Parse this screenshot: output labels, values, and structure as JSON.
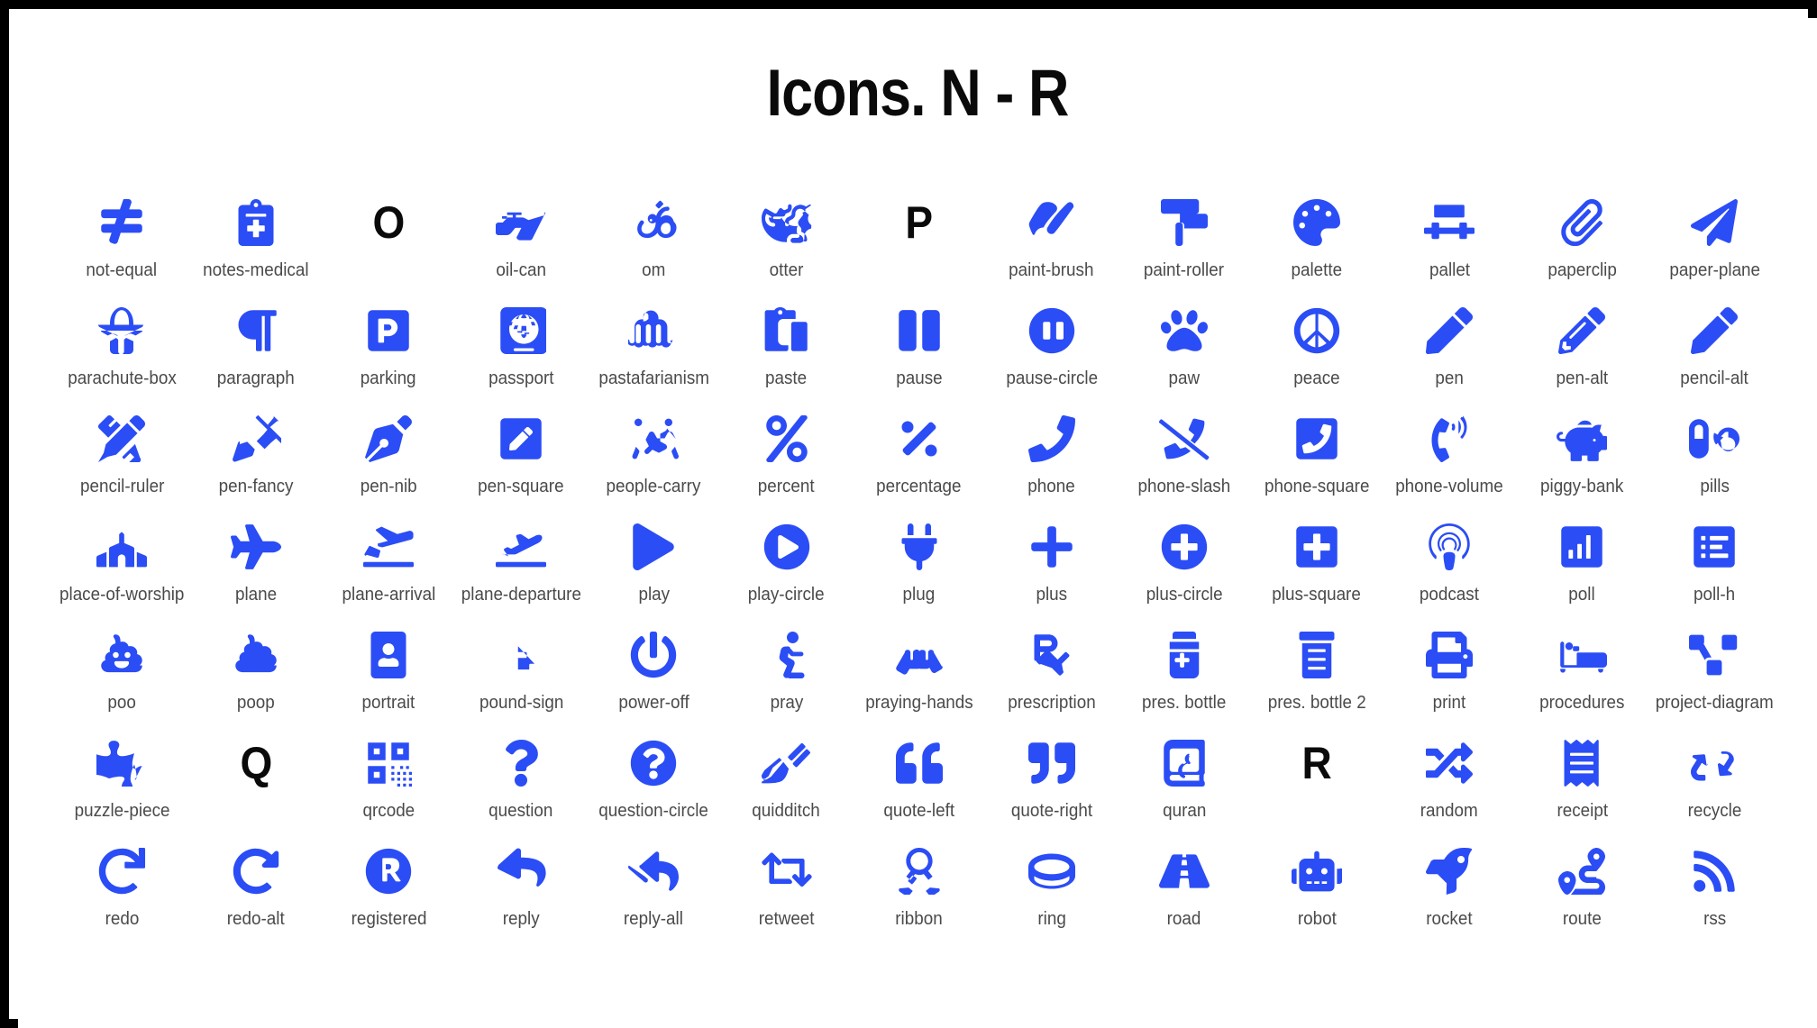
{
  "page": {
    "title": "Icons. N - R",
    "icon_color": "#2b4df5",
    "label_color": "#4a4a4a",
    "title_color": "#0a0a0a",
    "background_color": "#ffffff",
    "frame_color": "#000000",
    "columns": 13,
    "rows": 7
  },
  "icons": [
    {
      "label": "not-equal",
      "glyph": "not-equal-icon",
      "type": "icon"
    },
    {
      "label": "notes-medical",
      "glyph": "notes-medical-icon",
      "type": "icon"
    },
    {
      "label": "",
      "glyph": "letter-o",
      "type": "letter",
      "letter": "O"
    },
    {
      "label": "oil-can",
      "glyph": "oil-can-icon",
      "type": "icon"
    },
    {
      "label": "om",
      "glyph": "om-icon",
      "type": "icon"
    },
    {
      "label": "otter",
      "glyph": "otter-icon",
      "type": "icon"
    },
    {
      "label": "",
      "glyph": "letter-p",
      "type": "letter",
      "letter": "P"
    },
    {
      "label": "paint-brush",
      "glyph": "paint-brush-icon",
      "type": "icon"
    },
    {
      "label": "paint-roller",
      "glyph": "paint-roller-icon",
      "type": "icon"
    },
    {
      "label": "palette",
      "glyph": "palette-icon",
      "type": "icon"
    },
    {
      "label": "pallet",
      "glyph": "pallet-icon",
      "type": "icon"
    },
    {
      "label": "paperclip",
      "glyph": "paperclip-icon",
      "type": "icon"
    },
    {
      "label": "paper-plane",
      "glyph": "paper-plane-icon",
      "type": "icon"
    },
    {
      "label": "parachute-box",
      "glyph": "parachute-box-icon",
      "type": "icon"
    },
    {
      "label": "paragraph",
      "glyph": "paragraph-icon",
      "type": "icon"
    },
    {
      "label": "parking",
      "glyph": "parking-icon",
      "type": "icon"
    },
    {
      "label": "passport",
      "glyph": "passport-icon",
      "type": "icon"
    },
    {
      "label": "pastafarianism",
      "glyph": "pastafarianism-icon",
      "type": "icon"
    },
    {
      "label": "paste",
      "glyph": "paste-icon",
      "type": "icon"
    },
    {
      "label": "pause",
      "glyph": "pause-icon",
      "type": "icon"
    },
    {
      "label": "pause-circle",
      "glyph": "pause-circle-icon",
      "type": "icon"
    },
    {
      "label": "paw",
      "glyph": "paw-icon",
      "type": "icon"
    },
    {
      "label": "peace",
      "glyph": "peace-icon",
      "type": "icon"
    },
    {
      "label": "pen",
      "glyph": "pen-icon",
      "type": "icon"
    },
    {
      "label": "pen-alt",
      "glyph": "pen-alt-icon",
      "type": "icon"
    },
    {
      "label": "pencil-alt",
      "glyph": "pencil-alt-icon",
      "type": "icon"
    },
    {
      "label": "pencil-ruler",
      "glyph": "pencil-ruler-icon",
      "type": "icon"
    },
    {
      "label": "pen-fancy",
      "glyph": "pen-fancy-icon",
      "type": "icon"
    },
    {
      "label": "pen-nib",
      "glyph": "pen-nib-icon",
      "type": "icon"
    },
    {
      "label": "pen-square",
      "glyph": "pen-square-icon",
      "type": "icon"
    },
    {
      "label": "people-carry",
      "glyph": "people-carry-icon",
      "type": "icon"
    },
    {
      "label": "percent",
      "glyph": "percent-icon",
      "type": "icon"
    },
    {
      "label": "percentage",
      "glyph": "percentage-icon",
      "type": "icon"
    },
    {
      "label": "phone",
      "glyph": "phone-icon",
      "type": "icon"
    },
    {
      "label": "phone-slash",
      "glyph": "phone-slash-icon",
      "type": "icon"
    },
    {
      "label": "phone-square",
      "glyph": "phone-square-icon",
      "type": "icon"
    },
    {
      "label": "phone-volume",
      "glyph": "phone-volume-icon",
      "type": "icon"
    },
    {
      "label": "piggy-bank",
      "glyph": "piggy-bank-icon",
      "type": "icon"
    },
    {
      "label": "pills",
      "glyph": "pills-icon",
      "type": "icon"
    },
    {
      "label": "place-of-worship",
      "glyph": "place-of-worship-icon",
      "type": "icon"
    },
    {
      "label": "plane",
      "glyph": "plane-icon",
      "type": "icon"
    },
    {
      "label": "plane-arrival",
      "glyph": "plane-arrival-icon",
      "type": "icon"
    },
    {
      "label": "plane-departure",
      "glyph": "plane-departure-icon",
      "type": "icon"
    },
    {
      "label": "play",
      "glyph": "play-icon",
      "type": "icon"
    },
    {
      "label": "play-circle",
      "glyph": "play-circle-icon",
      "type": "icon"
    },
    {
      "label": "plug",
      "glyph": "plug-icon",
      "type": "icon"
    },
    {
      "label": "plus",
      "glyph": "plus-icon",
      "type": "icon"
    },
    {
      "label": "plus-circle",
      "glyph": "plus-circle-icon",
      "type": "icon"
    },
    {
      "label": "plus-square",
      "glyph": "plus-square-icon",
      "type": "icon"
    },
    {
      "label": "podcast",
      "glyph": "podcast-icon",
      "type": "icon"
    },
    {
      "label": "poll",
      "glyph": "poll-icon",
      "type": "icon"
    },
    {
      "label": "poll-h",
      "glyph": "poll-h-icon",
      "type": "icon"
    },
    {
      "label": "poo",
      "glyph": "poo-icon",
      "type": "icon"
    },
    {
      "label": "poop",
      "glyph": "poop-icon",
      "type": "icon"
    },
    {
      "label": "portrait",
      "glyph": "portrait-icon",
      "type": "icon"
    },
    {
      "label": "pound-sign",
      "glyph": "pound-sign-icon",
      "type": "icon"
    },
    {
      "label": "power-off",
      "glyph": "power-off-icon",
      "type": "icon"
    },
    {
      "label": "pray",
      "glyph": "pray-icon",
      "type": "icon"
    },
    {
      "label": "praying-hands",
      "glyph": "praying-hands-icon",
      "type": "icon"
    },
    {
      "label": "prescription",
      "glyph": "prescription-icon",
      "type": "icon"
    },
    {
      "label": "pres. bottle",
      "glyph": "prescription-bottle-icon",
      "type": "icon"
    },
    {
      "label": "pres. bottle 2",
      "glyph": "prescription-bottle-alt-icon",
      "type": "icon"
    },
    {
      "label": "print",
      "glyph": "print-icon",
      "type": "icon"
    },
    {
      "label": "procedures",
      "glyph": "procedures-icon",
      "type": "icon"
    },
    {
      "label": "project-diagram",
      "glyph": "project-diagram-icon",
      "type": "icon"
    },
    {
      "label": "puzzle-piece",
      "glyph": "puzzle-piece-icon",
      "type": "icon"
    },
    {
      "label": "",
      "glyph": "letter-q",
      "type": "letter",
      "letter": "Q"
    },
    {
      "label": "qrcode",
      "glyph": "qrcode-icon",
      "type": "icon"
    },
    {
      "label": "question",
      "glyph": "question-icon",
      "type": "icon"
    },
    {
      "label": "question-circle",
      "glyph": "question-circle-icon",
      "type": "icon"
    },
    {
      "label": "quidditch",
      "glyph": "quidditch-icon",
      "type": "icon"
    },
    {
      "label": "quote-left",
      "glyph": "quote-left-icon",
      "type": "icon"
    },
    {
      "label": "quote-right",
      "glyph": "quote-right-icon",
      "type": "icon"
    },
    {
      "label": "quran",
      "glyph": "quran-icon",
      "type": "icon"
    },
    {
      "label": "",
      "glyph": "letter-r",
      "type": "letter",
      "letter": "R"
    },
    {
      "label": "random",
      "glyph": "random-icon",
      "type": "icon"
    },
    {
      "label": "receipt",
      "glyph": "receipt-icon",
      "type": "icon"
    },
    {
      "label": "recycle",
      "glyph": "recycle-icon",
      "type": "icon"
    },
    {
      "label": "redo",
      "glyph": "redo-icon",
      "type": "icon"
    },
    {
      "label": "redo-alt",
      "glyph": "redo-alt-icon",
      "type": "icon"
    },
    {
      "label": "registered",
      "glyph": "registered-icon",
      "type": "icon"
    },
    {
      "label": "reply",
      "glyph": "reply-icon",
      "type": "icon"
    },
    {
      "label": "reply-all",
      "glyph": "reply-all-icon",
      "type": "icon"
    },
    {
      "label": "retweet",
      "glyph": "retweet-icon",
      "type": "icon"
    },
    {
      "label": "ribbon",
      "glyph": "ribbon-icon",
      "type": "icon"
    },
    {
      "label": "ring",
      "glyph": "ring-icon",
      "type": "icon"
    },
    {
      "label": "road",
      "glyph": "road-icon",
      "type": "icon"
    },
    {
      "label": "robot",
      "glyph": "robot-icon",
      "type": "icon"
    },
    {
      "label": "rocket",
      "glyph": "rocket-icon",
      "type": "icon"
    },
    {
      "label": "route",
      "glyph": "route-icon",
      "type": "icon"
    },
    {
      "label": "rss",
      "glyph": "rss-icon",
      "type": "icon"
    }
  ]
}
